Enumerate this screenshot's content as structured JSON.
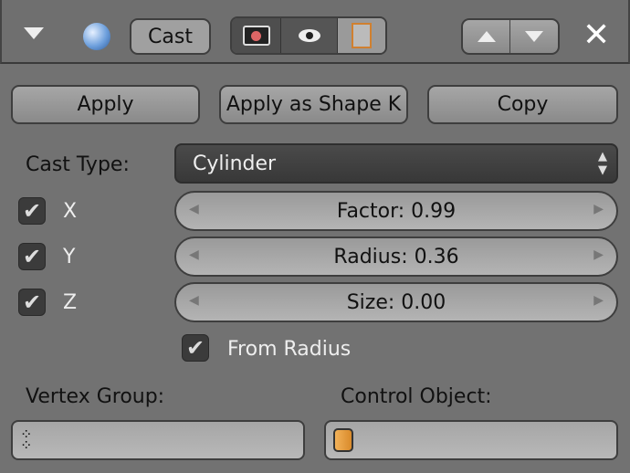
{
  "header": {
    "modifier_name": "Cast"
  },
  "actions": {
    "apply": "Apply",
    "apply_shape": "Apply as Shape K",
    "copy": "Copy"
  },
  "cast_type": {
    "label": "Cast Type:",
    "value": "Cylinder"
  },
  "axes": [
    {
      "label": "X",
      "checked": true
    },
    {
      "label": "Y",
      "checked": true
    },
    {
      "label": "Z",
      "checked": true
    }
  ],
  "sliders": [
    {
      "text": "Factor: 0.99",
      "value": 0.99
    },
    {
      "text": "Radius: 0.36",
      "value": 0.36
    },
    {
      "text": "Size: 0.00",
      "value": 0.0
    }
  ],
  "from_radius": {
    "label": "From Radius",
    "checked": true
  },
  "vertex_group": {
    "label": "Vertex Group:",
    "value": ""
  },
  "control_object": {
    "label": "Control Object:",
    "value": ""
  }
}
